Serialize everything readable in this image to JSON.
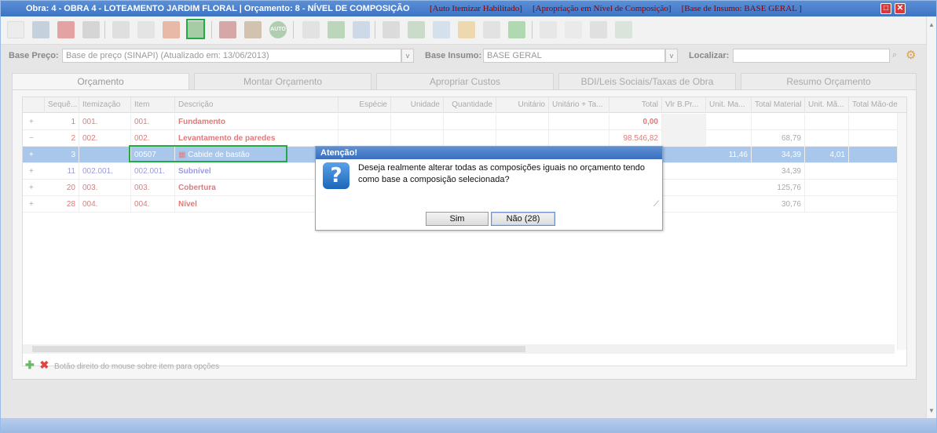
{
  "window": {
    "title": "Obra: 4 - OBRA 4 - LOTEAMENTO JARDIM FLORAL | Orçamento: 8 - NÍVEL DE COMPOSIÇÃO",
    "flags": [
      "[Auto Itemizar Habilitado]",
      "[Apropriação em Nível de Composição]",
      "[Base de Insumo: BASE GERAL ]"
    ],
    "restore_label": "□",
    "close_label": "✕"
  },
  "filters": {
    "base_preco_label": "Base Preço:",
    "base_preco_value": "Base de preço (SINAPI) (Atualizado em: 13/06/2013)",
    "base_insumo_label": "Base Insumo:",
    "base_insumo_value": "BASE GERAL",
    "localizar_label": "Localizar:",
    "localizar_value": ""
  },
  "tabs": [
    {
      "label": "Orçamento"
    },
    {
      "label": "Montar Orçamento"
    },
    {
      "label": "Apropriar Custos"
    },
    {
      "label": "BDI/Leis Sociais/Taxas de Obra"
    },
    {
      "label": "Resumo Orçamento"
    }
  ],
  "grid": {
    "columns": [
      "Sequê...",
      "Itemização",
      "Item",
      "Descrição",
      "Espécie",
      "Unidade",
      "Quantidade",
      "Unitário",
      "Unitário + Ta...",
      "Total",
      "Vlr B.Pr...",
      "Unit. Ma...",
      "Total Material",
      "Unit. Mã...",
      "Total Mão-de"
    ],
    "rows": [
      {
        "expand": "+",
        "seq": "1",
        "itemizacao": "001.",
        "item": "001.",
        "descricao": "Fundamento",
        "total": "0,00",
        "unit_mat": "",
        "total_mat": "",
        "unit_mao": ""
      },
      {
        "expand": "−",
        "seq": "2",
        "itemizacao": "002.",
        "item": "002.",
        "descricao": "Levantamento de paredes",
        "total": "98.546,82",
        "unit_mat": "",
        "total_mat": "68,79",
        "unit_mao": ""
      },
      {
        "expand": "+",
        "seq": "3",
        "itemizacao": "",
        "item": "00507",
        "descricao": "Cabide de bastão",
        "total": "",
        "unit_mat": "11,46",
        "total_mat": "34,39",
        "unit_mao": "4,01"
      },
      {
        "expand": "+",
        "seq": "11",
        "itemizacao": "002.001.",
        "item": "002.001.",
        "descricao": "Subnível",
        "total": "",
        "unit_mat": "",
        "total_mat": "34,39",
        "unit_mao": ""
      },
      {
        "expand": "+",
        "seq": "20",
        "itemizacao": "003.",
        "item": "003.",
        "descricao": "Cobertura",
        "total": "",
        "unit_mat": "",
        "total_mat": "125,76",
        "unit_mao": ""
      },
      {
        "expand": "+",
        "seq": "28",
        "itemizacao": "004.",
        "item": "004.",
        "descricao": "Nível",
        "total": "",
        "unit_mat": "",
        "total_mat": "30,76",
        "unit_mao": ""
      }
    ]
  },
  "footer": {
    "hint": "Botão direito do mouse sobre item para opções"
  },
  "toolbar": {
    "auto_label": "AUTO"
  },
  "dialog": {
    "title": "Atenção!",
    "icon": "?",
    "message": "Deseja realmente alterar todas as composições iguais no orçamento tendo como base a composição selecionada?",
    "yes_label": "Sim",
    "no_label": "Não (28)"
  }
}
